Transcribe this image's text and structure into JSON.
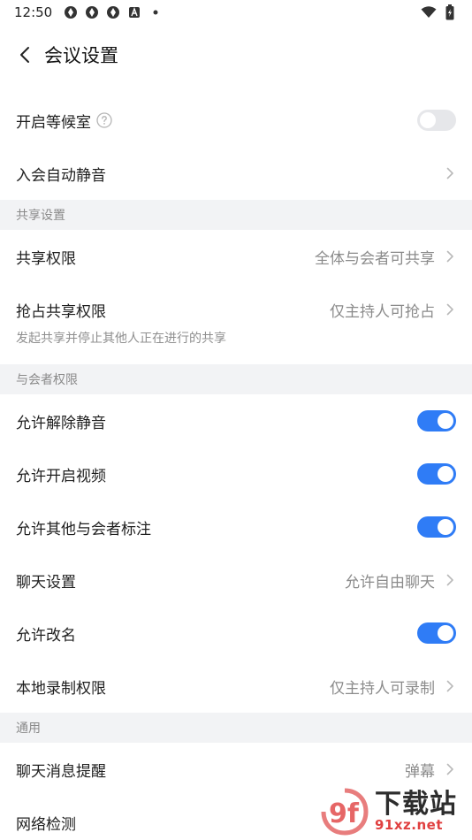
{
  "status_bar": {
    "time": "12:50"
  },
  "nav": {
    "title": "会议设置"
  },
  "top_rows": [
    {
      "label": "开启等候室",
      "has_help": true
    },
    {
      "label": "入会自动静音"
    }
  ],
  "sections": {
    "share": {
      "header": "共享设置",
      "rows": [
        {
          "label": "共享权限",
          "value": "全体与会者可共享"
        },
        {
          "label": "抢占共享权限",
          "value": "仅主持人可抢占"
        }
      ],
      "note": "发起共享并停止其他人正在进行的共享"
    },
    "participants": {
      "header": "与会者权限",
      "rows": [
        {
          "label": "允许解除静音"
        },
        {
          "label": "允许开启视频"
        },
        {
          "label": "允许其他与会者标注"
        },
        {
          "label": "聊天设置",
          "value": "允许自由聊天"
        },
        {
          "label": "允许改名"
        },
        {
          "label": "本地录制权限",
          "value": "仅主持人可录制"
        }
      ]
    },
    "general": {
      "header": "通用",
      "rows": [
        {
          "label": "聊天消息提醒",
          "value": "弹幕"
        },
        {
          "label": "网络检测"
        }
      ]
    }
  },
  "watermark": {
    "logo_text": "9f",
    "title": "下载站",
    "url": "91xz.net"
  },
  "colors": {
    "accent": "#2f7cf6",
    "toggle_off": "#e6e7ea",
    "section_bg": "#f2f3f5"
  }
}
